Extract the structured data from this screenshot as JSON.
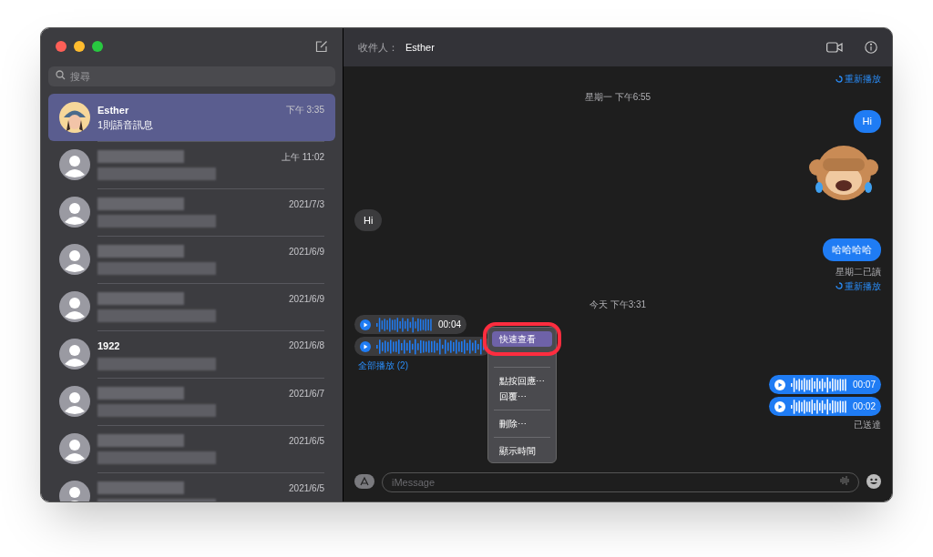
{
  "sidebar": {
    "search": {
      "placeholder": "搜尋"
    },
    "conversations": [
      {
        "kind": "memoji",
        "name": "Esther",
        "preview": "1則語音訊息",
        "time": "下午 3:35",
        "selected": true
      },
      {
        "kind": "placeholder",
        "time": "上午 11:02",
        "selected": false
      },
      {
        "kind": "placeholder",
        "time": "2021/7/3",
        "selected": false
      },
      {
        "kind": "placeholder",
        "time": "2021/6/9",
        "selected": false
      },
      {
        "kind": "placeholder",
        "time": "2021/6/9",
        "selected": false
      },
      {
        "kind": "placeholder",
        "name": "1922",
        "time": "2021/6/8",
        "selected": false
      },
      {
        "kind": "placeholder",
        "time": "2021/6/7",
        "selected": false
      },
      {
        "kind": "placeholder",
        "time": "2021/6/5",
        "selected": false
      },
      {
        "kind": "placeholder",
        "time": "2021/6/5",
        "selected": false
      }
    ]
  },
  "chat": {
    "recipient_label": "收件人：",
    "recipient": "Esther",
    "messages": [
      {
        "kind": "replay",
        "text": "重新播放"
      },
      {
        "kind": "timestamp",
        "text": "星期一 下午6:55"
      },
      {
        "kind": "text",
        "outgoing": true,
        "text": "Hi"
      },
      {
        "kind": "sticker"
      },
      {
        "kind": "text",
        "outgoing": false,
        "text": "Hi"
      },
      {
        "kind": "text",
        "outgoing": true,
        "text": "哈哈哈哈"
      },
      {
        "kind": "receipt",
        "text": "星期二已讀"
      },
      {
        "kind": "replay",
        "text": "重新播放"
      },
      {
        "kind": "timestamp",
        "text": "今天 下午3:31"
      },
      {
        "kind": "audio",
        "outgoing": false,
        "duration": "00:04"
      },
      {
        "kind": "audio",
        "outgoing": false
      },
      {
        "kind": "play_all",
        "text": "全部播放 (2)"
      },
      {
        "kind": "audio",
        "outgoing": true,
        "duration": "00:07"
      },
      {
        "kind": "audio",
        "outgoing": true,
        "duration": "00:02"
      },
      {
        "kind": "receipt",
        "text": "已送達"
      }
    ],
    "input": {
      "placeholder": "iMessage"
    }
  },
  "context_menu": {
    "items": [
      {
        "kind": "item",
        "label": "快速查看",
        "selected": true
      },
      {
        "kind": "divider"
      },
      {
        "kind": "item",
        "label": "點按回應⋯",
        "selected": false
      },
      {
        "kind": "item",
        "label": "回覆⋯",
        "selected": false
      },
      {
        "kind": "divider"
      },
      {
        "kind": "item",
        "label": "刪除⋯",
        "selected": false
      },
      {
        "kind": "divider"
      },
      {
        "kind": "item",
        "label": "顯示時間",
        "selected": false
      }
    ]
  }
}
